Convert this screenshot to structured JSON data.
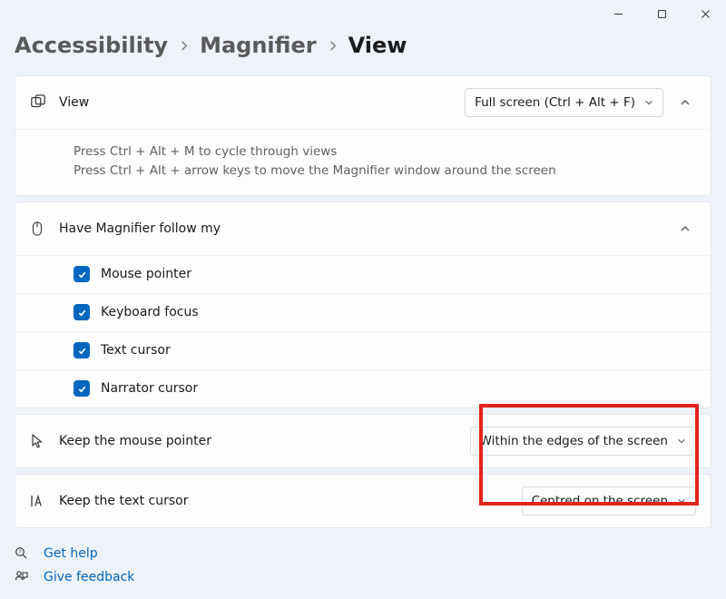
{
  "breadcrumb": {
    "items": [
      "Accessibility",
      "Magnifier",
      "View"
    ],
    "current_index": 2
  },
  "view_section": {
    "label": "View",
    "selected": "Full screen (Ctrl + Alt + F)",
    "hint_line1": "Press Ctrl + Alt + M to cycle through views",
    "hint_line2": "Press Ctrl + Alt + arrow keys to move the Magnifier window around the screen"
  },
  "follow_section": {
    "label": "Have Magnifier follow my",
    "options": [
      {
        "label": "Mouse pointer",
        "checked": true
      },
      {
        "label": "Keyboard focus",
        "checked": true
      },
      {
        "label": "Text cursor",
        "checked": true
      },
      {
        "label": "Narrator cursor",
        "checked": true
      }
    ]
  },
  "mouse_row": {
    "label": "Keep the mouse pointer",
    "selected": "Within the edges of the screen"
  },
  "text_row": {
    "label": "Keep the text cursor",
    "selected": "Centred on the screen"
  },
  "footer": {
    "help": "Get help",
    "feedback": "Give feedback"
  }
}
